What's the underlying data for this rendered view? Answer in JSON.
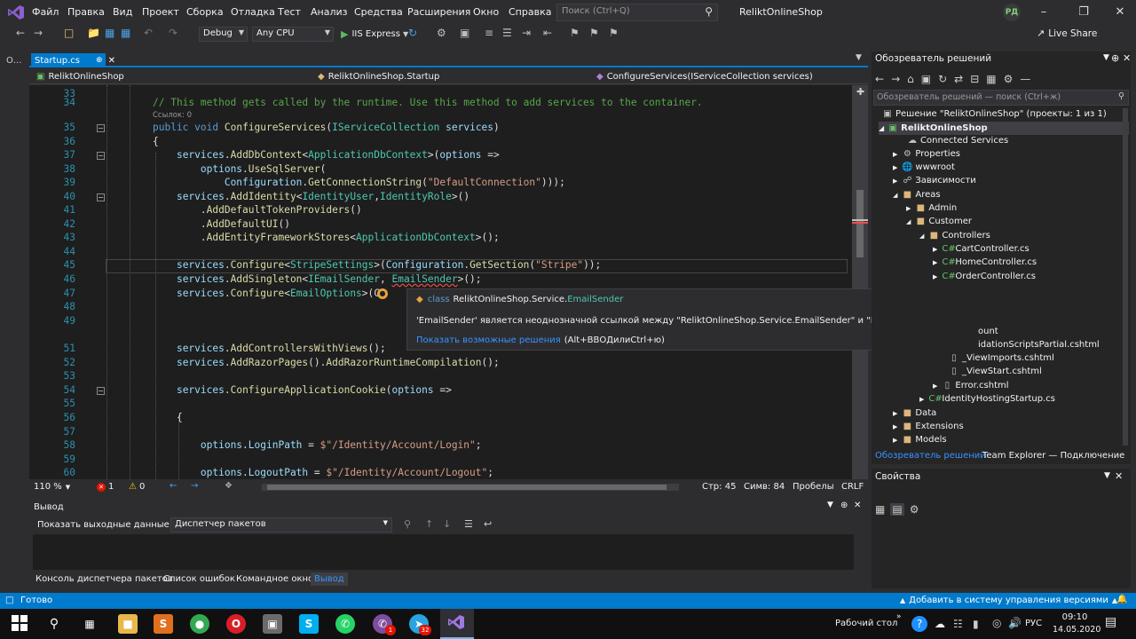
{
  "titlebar": {
    "menu": [
      "Файл",
      "Правка",
      "Вид",
      "Проект",
      "Сборка",
      "Отладка",
      "Тест",
      "Анализ",
      "Средства",
      "Расширения",
      "Окно",
      "Справка"
    ],
    "search_placeholder": "Поиск (Ctrl+Q)",
    "app_title": "ReliktOnlineShop",
    "avatar": "РД"
  },
  "toolbar": {
    "config": "Debug",
    "platform": "Any CPU",
    "run": "IIS Express",
    "live_share": "Live Share"
  },
  "left_strip_label": "О...",
  "editor": {
    "tab": "Startup.cs",
    "nav_project": "ReliktOnlineShop",
    "nav_class": "ReliktOnlineShop.Startup",
    "nav_member": "ConfigureServices(IServiceCollection services)",
    "refs_label": "Ссылок: 0",
    "zoom": "110 %",
    "errors": "1",
    "warnings": "0",
    "line": "Стр: 45",
    "col": "Симв: 84",
    "spaces": "Пробелы",
    "eol": "CRLF"
  },
  "tooltip": {
    "kind": "class",
    "ns": "ReliktOnlineShop.Service.",
    "cls": "EmailSender",
    "message": "'EmailSender' является неоднозначной ссылкой между \"ReliktOnlineShop.Service.EmailSender\" и \"ReliktOnlineShop.Services.EmailSender\".",
    "fix_link": "Показать возможные решения",
    "fix_shortcut": "(Alt+ВВОДилиCtrl+ю)"
  },
  "output": {
    "title": "Вывод",
    "show_label": "Показать выходные данные из:",
    "source": "Диспетчер пакетов"
  },
  "bottom_tabs": [
    "Консоль диспетчера пакетов",
    "Список ошибок",
    "Командное окно",
    "Вывод"
  ],
  "solution_explorer": {
    "title": "Обозреватель решений",
    "search_placeholder": "Обозреватель решений — поиск (Ctrl+ж)",
    "items": [
      {
        "label": "Решение \"ReliktOnlineShop\" (проекты: 1 из 1)",
        "icon": "solution-icon"
      },
      {
        "label": "ReliktOnlineShop",
        "icon": "project-icon"
      },
      {
        "label": "Connected Services",
        "icon": "services-icon"
      },
      {
        "label": "Properties",
        "icon": "wrench-icon"
      },
      {
        "label": "wwwroot",
        "icon": "globe-icon"
      },
      {
        "label": "Зависимости",
        "icon": "dependencies-icon"
      },
      {
        "label": "Areas",
        "icon": "folder-icon"
      },
      {
        "label": "Admin",
        "icon": "folder-icon"
      },
      {
        "label": "Customer",
        "icon": "folder-icon"
      },
      {
        "label": "Controllers",
        "icon": "folder-icon"
      },
      {
        "label": "CartController.cs",
        "icon": "csharp-icon"
      },
      {
        "label": "HomeController.cs",
        "icon": "csharp-icon"
      },
      {
        "label": "OrderController.cs",
        "icon": "csharp-icon"
      },
      {
        "label": "ount",
        "icon": "file-icon"
      },
      {
        "label": "idationScriptsPartial.cshtml",
        "icon": "file-icon"
      },
      {
        "label": "_ViewImports.cshtml",
        "icon": "file-icon"
      },
      {
        "label": "_ViewStart.cshtml",
        "icon": "file-icon"
      },
      {
        "label": "Error.cshtml",
        "icon": "file-icon"
      },
      {
        "label": "IdentityHostingStartup.cs",
        "icon": "csharp-icon"
      },
      {
        "label": "Data",
        "icon": "folder-icon"
      },
      {
        "label": "Extensions",
        "icon": "folder-icon"
      },
      {
        "label": "Models",
        "icon": "folder-icon"
      }
    ],
    "tabs": [
      "Обозреватель решений",
      "Team Explorer — Подключение"
    ]
  },
  "properties": {
    "title": "Свойства"
  },
  "status": {
    "ready": "Готово",
    "vcs": "Добавить в систему управления версиями"
  },
  "taskbar": {
    "desktop": "Рабочий стол",
    "lang": "РУС",
    "time": "09:10",
    "date": "14.05.2020",
    "badge_viber": "1",
    "badge_telegram": "32"
  }
}
